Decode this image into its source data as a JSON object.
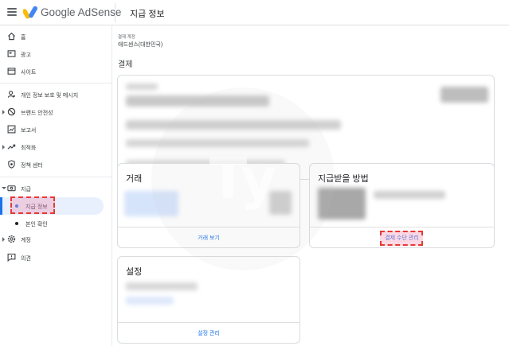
{
  "header": {
    "brand_google": "Google",
    "brand_product": "AdSense",
    "page_title": "지급 정보"
  },
  "sidebar": {
    "items": [
      {
        "label": "홈",
        "icon": "home-icon"
      },
      {
        "label": "광고",
        "icon": "ads-icon"
      },
      {
        "label": "사이트",
        "icon": "sites-icon"
      },
      {
        "label": "개인 정보 보호 및 메시지",
        "icon": "privacy-icon"
      },
      {
        "label": "브랜드 안전성",
        "icon": "block-icon"
      },
      {
        "label": "보고서",
        "icon": "reports-icon"
      },
      {
        "label": "최적화",
        "icon": "trending-icon"
      },
      {
        "label": "정책 센터",
        "icon": "shield-icon"
      },
      {
        "label": "지급",
        "icon": "payments-icon"
      },
      {
        "label": "계정",
        "icon": "settings-icon"
      },
      {
        "label": "의견",
        "icon": "feedback-icon"
      }
    ],
    "sub_items": [
      {
        "label": "지급 정보",
        "active": true
      },
      {
        "label": "본인 확인",
        "active": false
      }
    ]
  },
  "main": {
    "account_label": "결제 계정",
    "account_name": "애드센스(대한민국)",
    "section_title": "결제",
    "transactions": {
      "title": "거래",
      "link": "거래 보기"
    },
    "payment_methods": {
      "title": "지급받을 방법",
      "link": "결제 수단 관리"
    },
    "settings": {
      "title": "설정",
      "link": "설정 관리"
    }
  },
  "colors": {
    "accent": "#1a73e8",
    "highlight_border": "#e53935",
    "active_bg": "#e8f0fe"
  }
}
